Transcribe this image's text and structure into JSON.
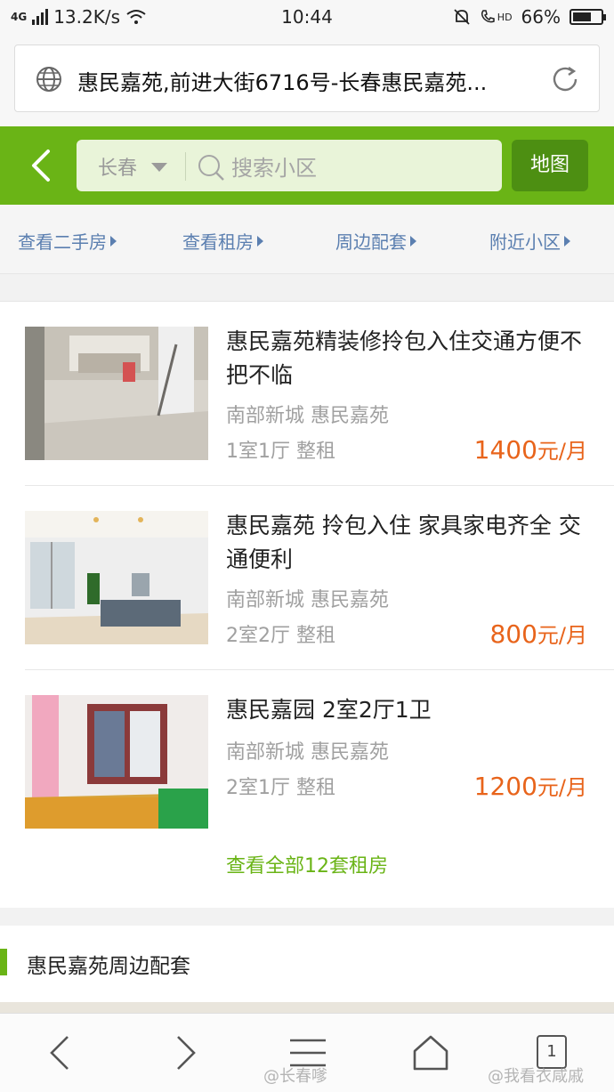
{
  "status_bar": {
    "network": "4G",
    "speed": "13.2K/s",
    "time": "10:44",
    "volte": "HD",
    "battery": "66%",
    "battery_level": 0.66
  },
  "browser": {
    "url_text": "惠民嘉苑,前进大街6716号-长春惠民嘉苑...",
    "tab_count": "1"
  },
  "header": {
    "city": "长春",
    "search_placeholder": "搜索小区",
    "map_button": "地图"
  },
  "tabs": [
    {
      "label": "查看二手房"
    },
    {
      "label": "查看租房"
    },
    {
      "label": "周边配套"
    },
    {
      "label": "附近小区"
    }
  ],
  "listings": [
    {
      "title": "惠民嘉苑精装修拎包入住交通方便不把不临",
      "location": "南部新城 惠民嘉苑",
      "rooms": "1室1厅 整租",
      "price": "1400",
      "unit": "元/月"
    },
    {
      "title": "惠民嘉苑 拎包入住 家具家电齐全 交通便利",
      "location": "南部新城 惠民嘉苑",
      "rooms": "2室2厅 整租",
      "price": "800",
      "unit": "元/月"
    },
    {
      "title": "惠民嘉园 2室2厅1卫",
      "location": "南部新城 惠民嘉苑",
      "rooms": "2室1厅 整租",
      "price": "1200",
      "unit": "元/月"
    }
  ],
  "view_all": "查看全部12套租房",
  "surrounding": {
    "title": "惠民嘉苑周边配套"
  },
  "watermarks": [
    "@长春嗲",
    "@我看衣咸戚"
  ],
  "colors": {
    "brand_green": "#6ab416",
    "dark_green": "#4d8f12",
    "price_orange": "#e8641b",
    "link_blue": "#5b7fb0"
  }
}
